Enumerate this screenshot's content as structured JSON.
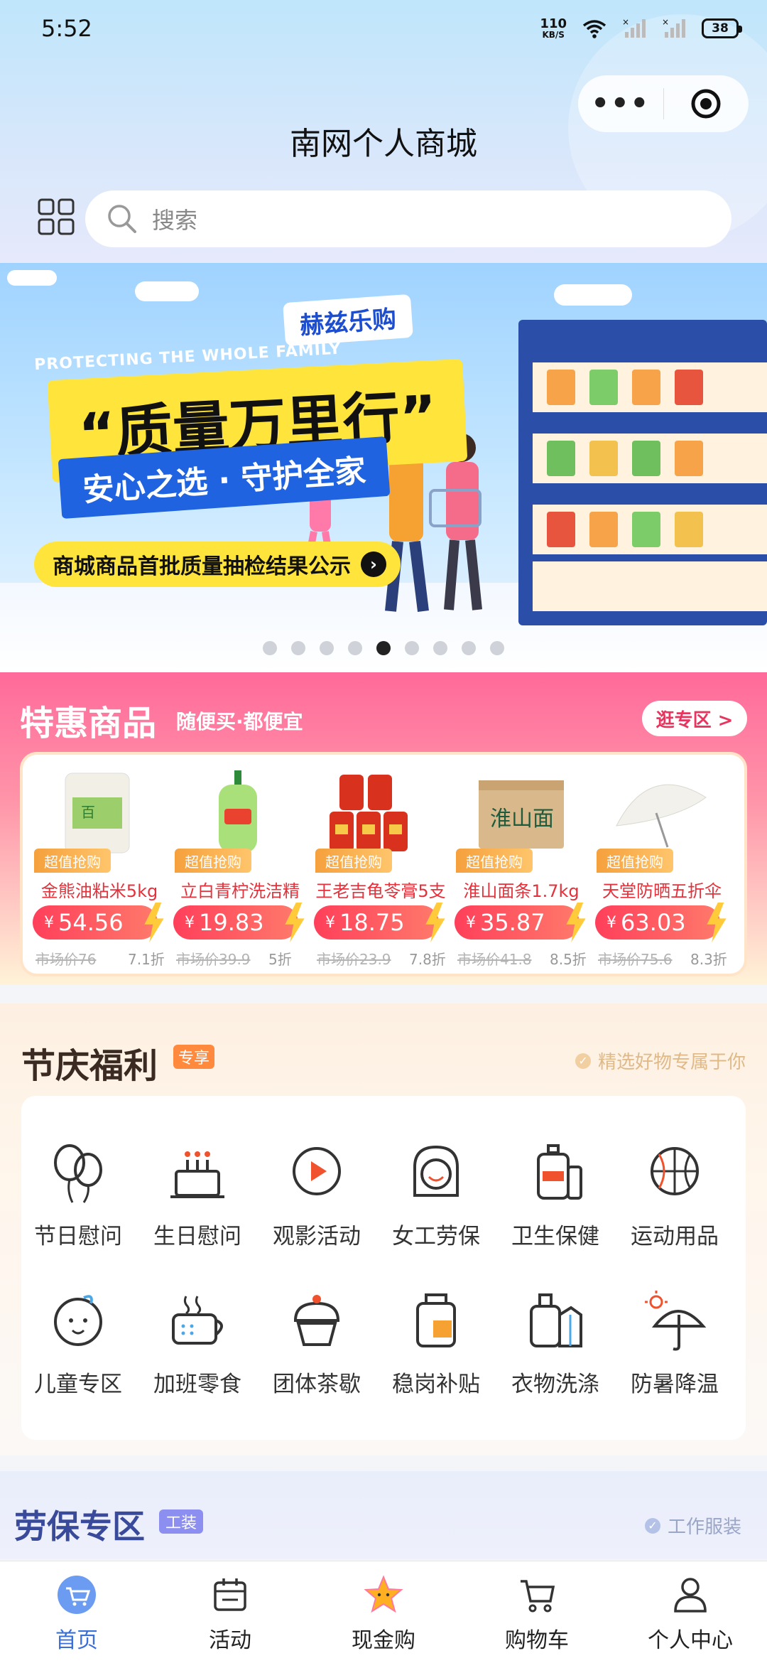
{
  "status_bar": {
    "time": "5:52",
    "net_speed_value": "110",
    "net_speed_unit": "KB/S",
    "battery": "38"
  },
  "capsule": {
    "more_icon": "more-dots-icon",
    "close_icon": "target-close-icon"
  },
  "header": {
    "title": "南网个人商城"
  },
  "search": {
    "placeholder": "搜索"
  },
  "banner": {
    "brand": "赫兹乐购",
    "english": "PROTECTING THE WHOLE FAMILY",
    "headline": "“质量万里行”",
    "tagline": "安心之选 · 守护全家",
    "cta": "商城商品首批质量抽检结果公示",
    "slide_count": 9,
    "active_slide": 5
  },
  "deals": {
    "title": "特惠商品",
    "subtitle": "随便买·都便宜",
    "more": "逛专区 >",
    "badge": "超值抢购",
    "products": [
      {
        "name": "金熊油粘米5kg",
        "price": "54.56",
        "market": "市场价76",
        "discount": "7.1折",
        "img": "rice-bag"
      },
      {
        "name": "立白青柠洗洁精",
        "price": "19.83",
        "market": "市场价39.9",
        "discount": "5折",
        "img": "detergent-bottle"
      },
      {
        "name": "王老吉龟苓膏5支",
        "price": "18.75",
        "market": "市场价23.9",
        "discount": "7.8折",
        "img": "jelly-pack"
      },
      {
        "name": "淮山面条1.7kg",
        "price": "35.87",
        "market": "市场价41.8",
        "discount": "8.5折",
        "img": "noodle-box"
      },
      {
        "name": "天堂防晒五折伞",
        "price": "63.03",
        "market": "市场价75.6",
        "discount": "8.3折",
        "img": "umbrella"
      }
    ],
    "currency": "¥"
  },
  "festival": {
    "title": "节庆福利",
    "tag": "专享",
    "note": "精选好物专属于你",
    "categories": [
      {
        "label": "节日慰问",
        "icon": "balloons-icon"
      },
      {
        "label": "生日慰问",
        "icon": "birthday-cake-icon"
      },
      {
        "label": "观影活动",
        "icon": "play-video-icon"
      },
      {
        "label": "女工劳保",
        "icon": "woman-face-icon"
      },
      {
        "label": "卫生保健",
        "icon": "hygiene-bottle-icon"
      },
      {
        "label": "运动用品",
        "icon": "basketball-icon"
      },
      {
        "label": "儿童专区",
        "icon": "baby-face-icon"
      },
      {
        "label": "加班零食",
        "icon": "snack-cup-icon"
      },
      {
        "label": "团体茶歇",
        "icon": "cupcake-icon"
      },
      {
        "label": "稳岗补贴",
        "icon": "grocery-jar-icon"
      },
      {
        "label": "衣物洗涤",
        "icon": "laundry-icon"
      },
      {
        "label": "防暑降温",
        "icon": "sun-umbrella-icon"
      }
    ]
  },
  "labor": {
    "title": "劳保专区",
    "tag": "工装",
    "note": "工作服装"
  },
  "tabbar": {
    "items": [
      {
        "label": "首页",
        "icon": "home-cart-icon",
        "active": true
      },
      {
        "label": "活动",
        "icon": "calendar-icon",
        "active": false
      },
      {
        "label": "现金购",
        "icon": "star-icon",
        "active": false
      },
      {
        "label": "购物车",
        "icon": "cart-icon",
        "active": false
      },
      {
        "label": "个人中心",
        "icon": "user-icon",
        "active": false
      }
    ]
  },
  "colors": {
    "accent_blue": "#3a6fd8",
    "deal_red": "#e3323b",
    "deal_price": "#ff3f5a",
    "festival_tag": "#ff8a3d",
    "labor_tag": "#8c8ef0"
  }
}
